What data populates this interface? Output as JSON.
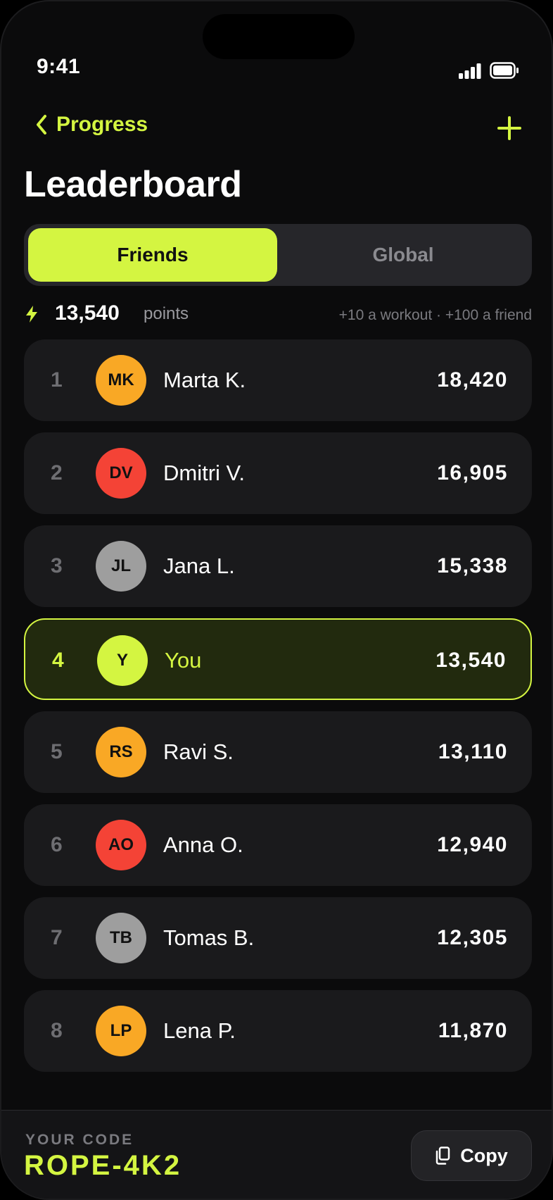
{
  "status_bar": {
    "time": "9:41"
  },
  "nav": {
    "back_label": "Progress"
  },
  "page_title": "Leaderboard",
  "segments": {
    "friends": "Friends",
    "global": "Global",
    "selected": "Friends"
  },
  "points_summary": {
    "value": "13,540",
    "unit": "points",
    "hint": "+10 a workout · +100 a friend"
  },
  "colors": {
    "accent": "#d4f541",
    "orange": "#f9a825",
    "red": "#f44336",
    "gray": "#9e9e9e"
  },
  "leaderboard": [
    {
      "rank": "1",
      "initials": "MK",
      "name": "Marta K.",
      "score": "18,420",
      "avatar_color": "#f9a825",
      "is_you": false
    },
    {
      "rank": "2",
      "initials": "DV",
      "name": "Dmitri V.",
      "score": "16,905",
      "avatar_color": "#f44336",
      "is_you": false
    },
    {
      "rank": "3",
      "initials": "JL",
      "name": "Jana L.",
      "score": "15,338",
      "avatar_color": "#9e9e9e",
      "is_you": false
    },
    {
      "rank": "4",
      "initials": "Y",
      "name": "You",
      "score": "13,540",
      "avatar_color": "#d4f541",
      "is_you": true
    },
    {
      "rank": "5",
      "initials": "RS",
      "name": "Ravi S.",
      "score": "13,110",
      "avatar_color": "#f9a825",
      "is_you": false
    },
    {
      "rank": "6",
      "initials": "AO",
      "name": "Anna O.",
      "score": "12,940",
      "avatar_color": "#f44336",
      "is_you": false
    },
    {
      "rank": "7",
      "initials": "TB",
      "name": "Tomas B.",
      "score": "12,305",
      "avatar_color": "#9e9e9e",
      "is_you": false
    },
    {
      "rank": "8",
      "initials": "LP",
      "name": "Lena P.",
      "score": "11,870",
      "avatar_color": "#f9a825",
      "is_you": false
    }
  ],
  "footer": {
    "code_label": "YOUR CODE",
    "code_value": "ROPE-4K2",
    "copy_label": "Copy"
  }
}
